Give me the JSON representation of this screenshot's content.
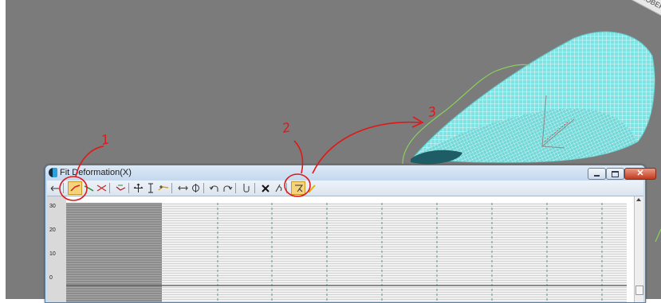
{
  "window": {
    "title": "Fit Deformation(X)",
    "close_glyph": "✕"
  },
  "viewport": {
    "corner_label": "ROBERT",
    "mesh_color": "#7fe3e3",
    "background_color": "#7b7b7b"
  },
  "toolbar": {
    "buttons": [
      {
        "name": "snap-icon",
        "glyph": "⇆"
      },
      {
        "name": "make-symmetrical-icon",
        "glyph": "⟋",
        "annotated": true
      },
      {
        "name": "display-x-axis-icon",
        "glyph": "⟍"
      },
      {
        "name": "display-xy-axes-icon",
        "glyph": "✕"
      },
      {
        "name": "swap-deform-curves-icon",
        "glyph": "⤳"
      },
      {
        "name": "move-control-point-icon",
        "glyph": "✥"
      },
      {
        "name": "scale-control-point-icon",
        "glyph": "I"
      },
      {
        "name": "insert-corner-point-icon",
        "glyph": "⁺"
      },
      {
        "name": "delete-control-point-icon",
        "glyph": "⊕"
      },
      {
        "name": "mirror-horizontally-icon",
        "glyph": "⇔"
      },
      {
        "name": "rotate-90-ccw-icon",
        "glyph": "↶"
      },
      {
        "name": "rotate-90-cw-icon",
        "glyph": "↷"
      },
      {
        "name": "delete-curve-icon",
        "glyph": "☡"
      },
      {
        "name": "reset-curve-icon",
        "glyph": "✕"
      },
      {
        "name": "get-shape-icon",
        "glyph": "⊘"
      },
      {
        "name": "generate-path-icon",
        "glyph": "⇲",
        "annotated": true
      },
      {
        "name": "lock-aspect-icon",
        "glyph": "✎"
      }
    ]
  },
  "graph": {
    "row_labels": [
      "30",
      "20",
      "10",
      "0"
    ]
  },
  "annotations": {
    "labels": [
      "1",
      "2",
      "3"
    ],
    "color": "#e01818"
  }
}
